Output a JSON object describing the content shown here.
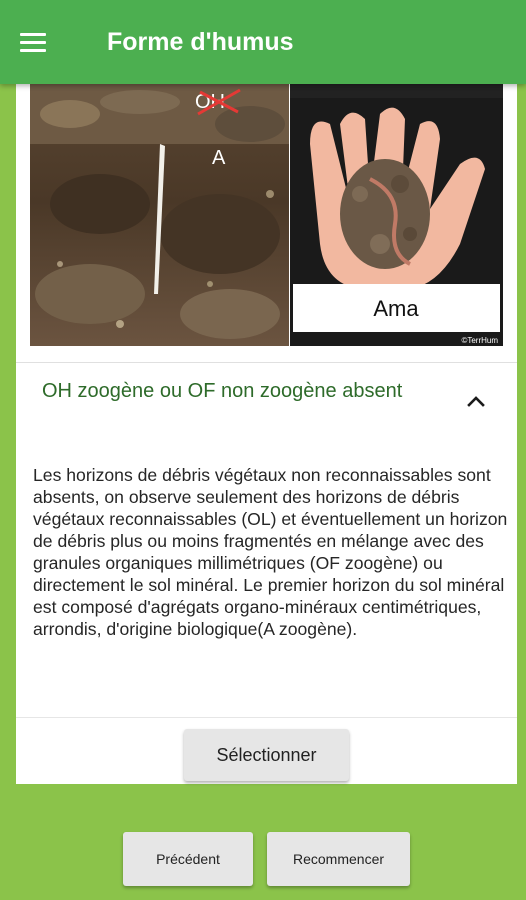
{
  "appbar": {
    "title": "Forme d'humus",
    "menu_icon": "hamburger-menu-icon"
  },
  "images": {
    "soil_label_strike": "OH",
    "soil_label": "A",
    "hand_label": "Ama",
    "copyright": "©TerrHum"
  },
  "section": {
    "title": "OH zoogène ou OF non zoogène absent",
    "toggle_icon": "chevron-up-icon",
    "description": "Les horizons de débris végétaux non reconnaissables sont absents, on observe seulement des horizons de débris végétaux reconnaissables (OL) et éventuellement un horizon de débris plus ou moins fragmentés en mélange avec des granules organiques millimétriques (OF zoogène) ou directement le sol minéral. Le premier horizon du sol minéral est composé d'agrégats organo-minéraux centimétriques, arrondis, d'origine biologique(A zoogène)."
  },
  "buttons": {
    "select": "Sélectionner",
    "previous": "Précédent",
    "restart": "Recommencer"
  },
  "colors": {
    "appbar": "#4caf50",
    "background": "#8bc34a",
    "section_title": "#2e6b2a"
  }
}
